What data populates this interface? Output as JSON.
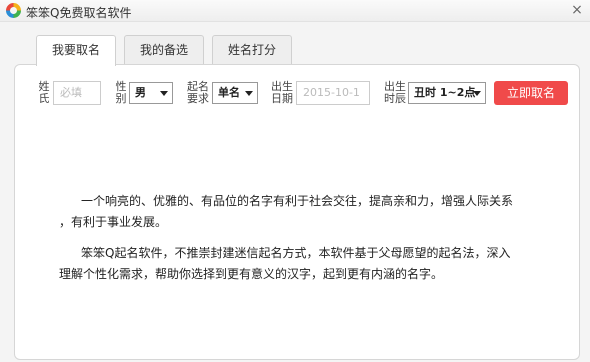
{
  "window": {
    "title": "笨笨Q免费取名软件",
    "close_icon": "×"
  },
  "tabs": [
    {
      "label": "我要取名"
    },
    {
      "label": "我的备选"
    },
    {
      "label": "姓名打分"
    }
  ],
  "form": {
    "surname": {
      "label_1": "姓",
      "label_2": "氏",
      "placeholder": "必填"
    },
    "gender": {
      "label_1": "性",
      "label_2": "别",
      "value": "男"
    },
    "naming": {
      "label_1": "起名",
      "label_2": "要求",
      "value": "单名"
    },
    "birth_date": {
      "label_1": "出生",
      "label_2": "日期",
      "placeholder": "2015-10-1"
    },
    "birth_hour": {
      "label_1": "出生",
      "label_2": "时辰",
      "value": "丑时 1~2点"
    },
    "submit_label": "立即取名"
  },
  "description": {
    "paragraph_1_line_1": "一个响亮的、优雅的、有品位的名字有利于社会交往，提高亲和力，增强人际关系",
    "paragraph_1_line_2": "，有利于事业发展。",
    "paragraph_2_line_1": "笨笨Q起名软件，不推崇封建迷信起名方式，本软件基于父母愿望的起名法，深入",
    "paragraph_2_line_2": "理解个性化需求，帮助你选择到更有意义的汉字，起到更有内涵的名字。"
  },
  "colors": {
    "accent": "#f04a4a"
  }
}
